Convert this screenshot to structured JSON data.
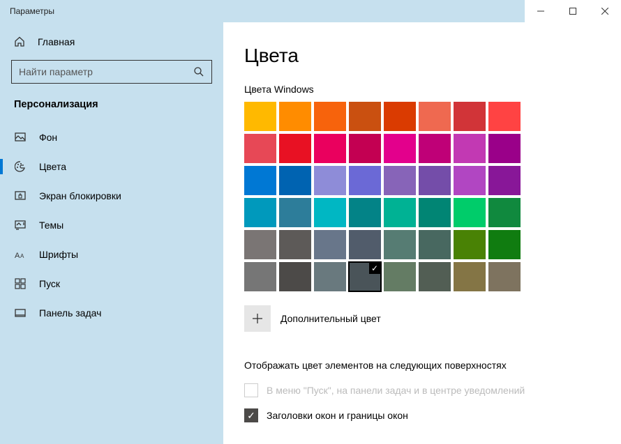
{
  "window": {
    "title": "Параметры"
  },
  "sidebar": {
    "home_label": "Главная",
    "search_placeholder": "Найти параметр",
    "section_title": "Персонализация",
    "items": [
      {
        "id": "bg",
        "label": "Фон"
      },
      {
        "id": "colors",
        "label": "Цвета"
      },
      {
        "id": "lock",
        "label": "Экран блокировки"
      },
      {
        "id": "themes",
        "label": "Темы"
      },
      {
        "id": "fonts",
        "label": "Шрифты"
      },
      {
        "id": "start",
        "label": "Пуск"
      },
      {
        "id": "taskbar",
        "label": "Панель задач"
      }
    ],
    "selected": "colors"
  },
  "main": {
    "title": "Цвета",
    "palette_label": "Цвета Windows",
    "custom_color_label": "Дополнительный цвет",
    "surface_section": "Отображать цвет элементов на следующих поверхностях",
    "check_start": "В меню \"Пуск\", на панели задач и в центре уведомлений",
    "check_titlebars": "Заголовки окон и границы окон",
    "palette": [
      "#ffb900",
      "#ff8c00",
      "#f7630c",
      "#ca5010",
      "#da3b01",
      "#ef6950",
      "#d13438",
      "#ff4343",
      "#e74856",
      "#e81123",
      "#ea005e",
      "#c30052",
      "#e3008c",
      "#bf0077",
      "#c239b3",
      "#9a0089",
      "#0078d4",
      "#0063b1",
      "#8e8cd8",
      "#6b69d6",
      "#8764b8",
      "#744da9",
      "#b146c2",
      "#881798",
      "#0099bc",
      "#2d7d9a",
      "#00b7c3",
      "#038387",
      "#00b294",
      "#018574",
      "#00cc6a",
      "#10893e",
      "#7a7574",
      "#5d5a58",
      "#68768a",
      "#515c6b",
      "#567c73",
      "#486860",
      "#498205",
      "#107c10",
      "#767676",
      "#4c4a48",
      "#69797e",
      "#4a5459",
      "#647c64",
      "#525e54",
      "#847545",
      "#7e735f"
    ],
    "selected_swatch_index": 43
  }
}
